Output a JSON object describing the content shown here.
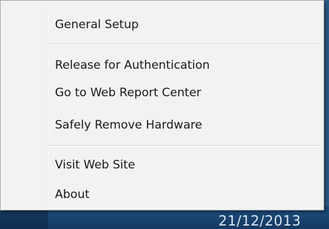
{
  "menu": {
    "items": [
      {
        "id": "general-setup",
        "label": "General Setup"
      },
      {
        "id": "release-auth",
        "label": "Release for Authentication"
      },
      {
        "id": "web-report-center",
        "label": "Go to Web Report Center"
      },
      {
        "id": "safely-remove",
        "label": "Safely Remove Hardware"
      },
      {
        "id": "visit-web-site",
        "label": "Visit Web Site"
      },
      {
        "id": "about",
        "label": "About"
      }
    ]
  },
  "taskbar": {
    "date": "21/12/2013"
  }
}
